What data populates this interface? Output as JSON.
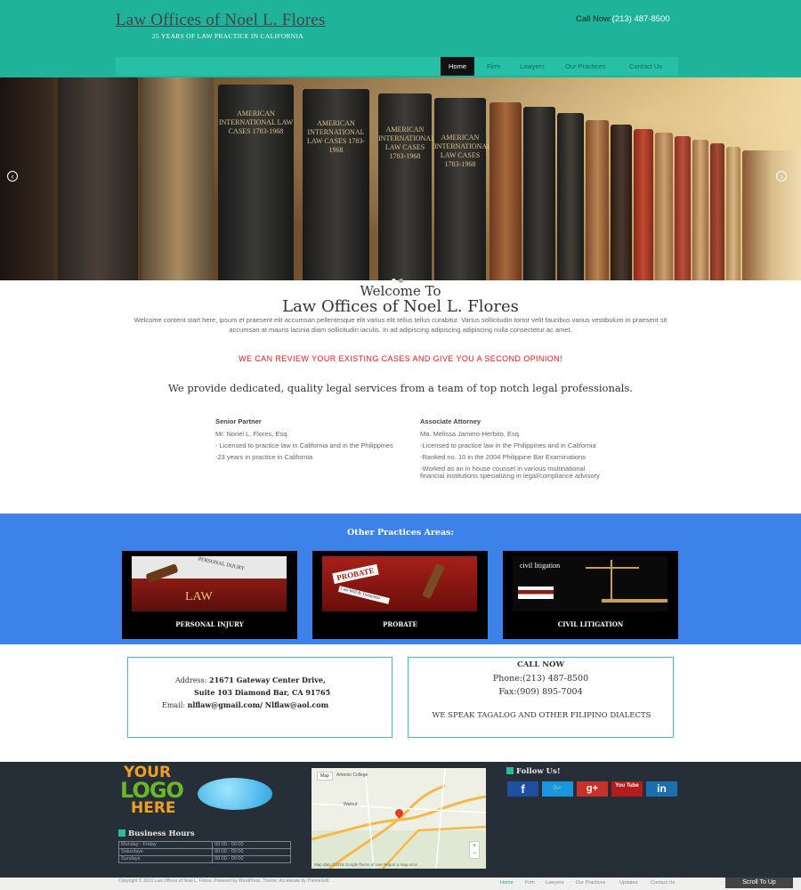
{
  "header": {
    "title": "Law Offices of Noel L. Flores",
    "tagline": "25 YEARS OF LAW PRACTICE IN CALIFORNIA",
    "call_label": "Call Now:",
    "call_number": "(213) 487-8500"
  },
  "nav": {
    "items": [
      "Home",
      "Firm",
      "Lawyers",
      "Our Practices",
      "Contact Us"
    ]
  },
  "hero": {
    "book_titles": [
      "AMERICAN INTERNATIONAL LAW CASES 1783-1968",
      "AMERICAN INTERNATIONAL LAW CASES 1783-1968",
      "AMERICAN INTERNATIONAL LAW CASES 1783-1968",
      "AMERICAN INTERNATIONAL LAW CASES 1783-1968"
    ],
    "prev_icon": "chevron-left-icon",
    "next_icon": "chevron-right-icon"
  },
  "welcome": {
    "line1": "Welcome To",
    "line2": "Law Offices of Noel L. Flores",
    "body": "Welcome content start here, ipsum et praesent elit accumsan pellentesque elit varius elit tellus tellus curabitur. Varius sollicitudin tortor velit faucibus varius vestibulum in praesent sit accumsan at mauris lacinia diam sollicitudin iaculis. In ad adipiscing adipiscing adipiscing nulla consectetur ac amet.",
    "offer": "WE CAN REVIEW YOUR EXISTING CASES AND GIVE YOU A SECOND OPINION!",
    "services": "We provide dedicated, quality legal services from a team of top notch legal professionals."
  },
  "attorneys": [
    {
      "role": "Senior Partner",
      "name": "Mr. Noriel L. Flores, Esq.",
      "points": [
        "- Licensed to practice law in California and in the Philippines",
        "-23 years in practice in California"
      ]
    },
    {
      "role": "Associate Attorney",
      "name": "Ma. Melissa Jamero-Herbito, Esq.",
      "points": [
        "-Licensed to practice law in the Philippines and in California",
        "-Ranked no. 10 in the 2004 Philippine Bar Examinations",
        "-Worked as an in house counsel in various multinational financial institutions specializing in legal/compliance advisory"
      ]
    }
  ],
  "practices": {
    "title": "Other Practices Areas:",
    "cards": [
      {
        "label": "PERSONAL INJURY",
        "img_text_1": "PERSONAL INJURY",
        "img_text_2": "LAW"
      },
      {
        "label": "PROBATE",
        "img_text_1": "PROBATE",
        "img_text_2": "Last Will & Testament"
      },
      {
        "label": "CIVIL LITIGATION",
        "img_text_1": "civil litigation",
        "img_text_2": ""
      }
    ]
  },
  "contact": {
    "address_label": "Address:",
    "address_1": "21671 Gateway Center Drive,",
    "address_2": "Suite 103 Diamond Bar, CA 91765",
    "email_label": "Email:",
    "email": "nlflaw@gmail.com/ Nlflaw@aol.com",
    "call_title": "CALL NOW",
    "phone": "Phone:(213) 487-8500",
    "fax": "Fax:(909) 895-7004",
    "languages": "WE SPEAK TAGALOG AND OTHER FILIPINO DIALECTS"
  },
  "footer": {
    "logo_lines": [
      "YOUR",
      "LOGO",
      "HERE"
    ],
    "map_button": "Map",
    "map_place": "Antonio College",
    "map_city": "Walnut",
    "map_footer": "Map data ©2016 Google  Terms of Use  Report a map error",
    "hours_title": "Business Hours",
    "hours": [
      {
        "day": "Monday - Friday",
        "time": "00:00 - 00:00"
      },
      {
        "day": "Saturdays",
        "time": "00:00 - 00:00"
      },
      {
        "day": "Sundays",
        "time": "00:00 - 00:00"
      }
    ],
    "follow_title": "Follow Us!",
    "social": [
      {
        "label": "f",
        "icon": "facebook-icon",
        "color": "#1f4fa0"
      },
      {
        "label": "🐦",
        "icon": "twitter-icon",
        "color": "#1c95e0"
      },
      {
        "label": "g+",
        "icon": "google-plus-icon",
        "color": "#c8302a"
      },
      {
        "label": "You Tube",
        "icon": "youtube-icon",
        "color": "#b51d1d"
      },
      {
        "label": "in",
        "icon": "linkedin-icon",
        "color": "#1b6fae"
      }
    ]
  },
  "bottom": {
    "copyright": "Copyright © 2016 Law Offices of Noel L. Flores. Powered by WordPress. Theme: Accelerate by ThemeGrill.",
    "nav": [
      "Home",
      "Firm",
      "Lawyers",
      "Our Practices",
      "Updates",
      "Contact Us"
    ],
    "scroll_top": "Scroll To Up"
  },
  "colors": {
    "header": "#1fb39b",
    "practices": "#3d82e8",
    "footer": "#262e38",
    "accent_red": "#e41b17"
  }
}
